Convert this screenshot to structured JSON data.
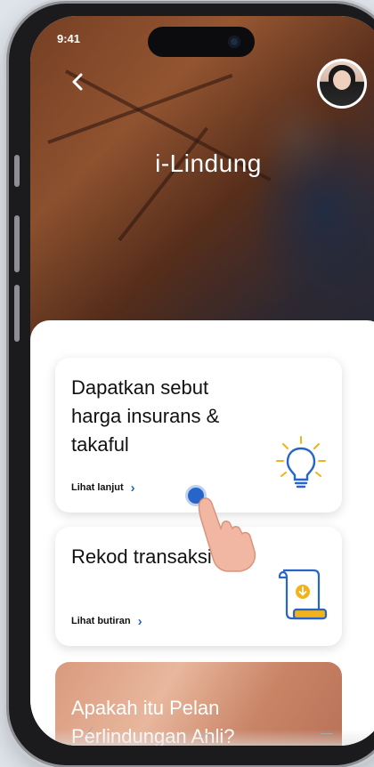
{
  "status_bar": {
    "time": "9:41"
  },
  "hero": {
    "title": "i-Lindung"
  },
  "cards": [
    {
      "title": "Dapatkan sebut harga insurans & takaful",
      "link_label": "Lihat lanjut",
      "icon": "lightbulb-icon"
    },
    {
      "title": "Rekod transaksi",
      "link_label": "Lihat butiran",
      "icon": "document-download-icon"
    },
    {
      "title": "Apakah itu Pelan Perlindungan Ahli?"
    }
  ],
  "colors": {
    "accent": "#2766C8",
    "icon_yellow": "#F2B21B",
    "icon_blue": "#2766C8"
  }
}
